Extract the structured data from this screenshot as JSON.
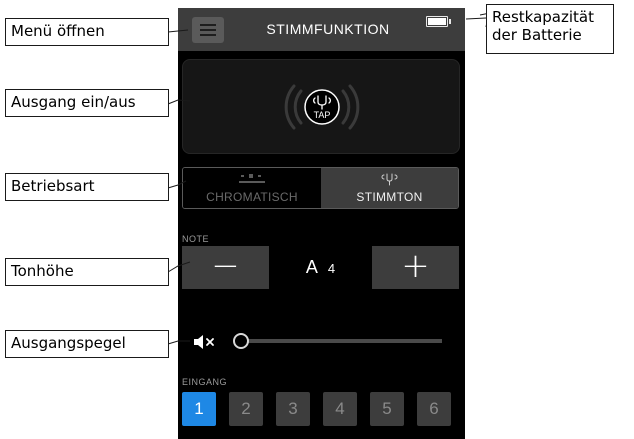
{
  "screen": {
    "title": "STIMMFUNKTION",
    "tap_label": "TAP",
    "mode": {
      "chromatic_label": "CHROMATISCH",
      "tone_label": "STIMMTON",
      "selected": "tone"
    },
    "note": {
      "label": "NOTE",
      "minus": "−",
      "plus": "+",
      "letter": "A",
      "octave": "4"
    },
    "output_level": {
      "value": 0,
      "muted": true
    },
    "input": {
      "label": "EINGANG",
      "buttons": [
        "1",
        "2",
        "3",
        "4",
        "5",
        "6"
      ],
      "selected_index": 0
    }
  },
  "callouts": {
    "menu": "Menü öffnen",
    "battery_line1": "Restkapazität",
    "battery_line2": "der Batterie",
    "output": "Ausgang ein/aus",
    "mode": "Betriebsart",
    "pitch": "Tonhöhe",
    "level": "Ausgangspegel"
  },
  "colors": {
    "screen_bg": "#000000",
    "bar_bg": "#3d3d3d",
    "accent": "#1e88e5",
    "callout_border": "#1a1a1a"
  },
  "icons": {
    "menu": "hamburger-icon",
    "battery": "battery-icon",
    "tap": "tuning-fork-icon",
    "mute": "speaker-muted-icon"
  }
}
